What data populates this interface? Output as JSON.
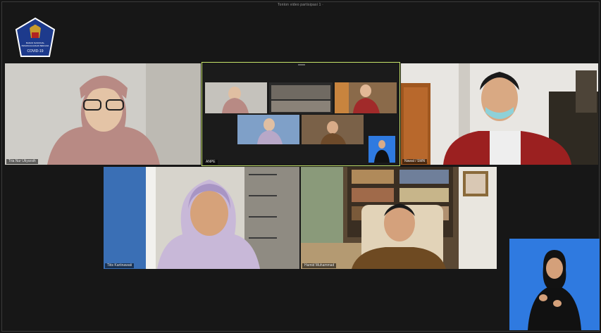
{
  "header": {
    "view_label": "Tonton video partisipasi 1 ·"
  },
  "logo": {
    "line1": "BADAN NASIONAL",
    "line2": "PENANGGULANGAN BENCANA",
    "line3": "COVID-19"
  },
  "participants": [
    {
      "name": "Tria Nur Utiyarsih"
    },
    {
      "name": "ANPE"
    },
    {
      "name": "Nawal / SMN"
    },
    {
      "name": "Titis Kartinawati"
    },
    {
      "name": "Hamid Muhammad"
    }
  ],
  "colors": {
    "active_speaker_border": "#c7e46a",
    "background": "#161616",
    "sign_interpreter_bg": "#2f7ae0"
  }
}
